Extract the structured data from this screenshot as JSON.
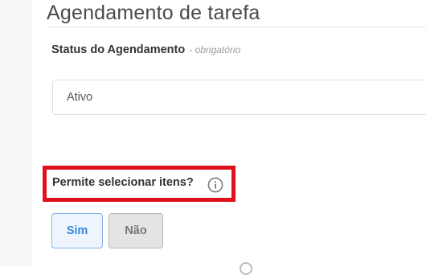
{
  "page": {
    "title": "Agendamento de tarefa"
  },
  "status_field": {
    "label": "Status do Agendamento",
    "required_hint": "- obrigatório",
    "selected_value": "Ativo"
  },
  "selection_field": {
    "label": "Permite selecionar itens?",
    "info_icon": "info-circle-icon",
    "options": [
      {
        "label": "Sim",
        "selected": true
      },
      {
        "label": "Não",
        "selected": false
      }
    ]
  },
  "colors": {
    "highlight": "#e0101c",
    "accent": "#3a86d8"
  }
}
